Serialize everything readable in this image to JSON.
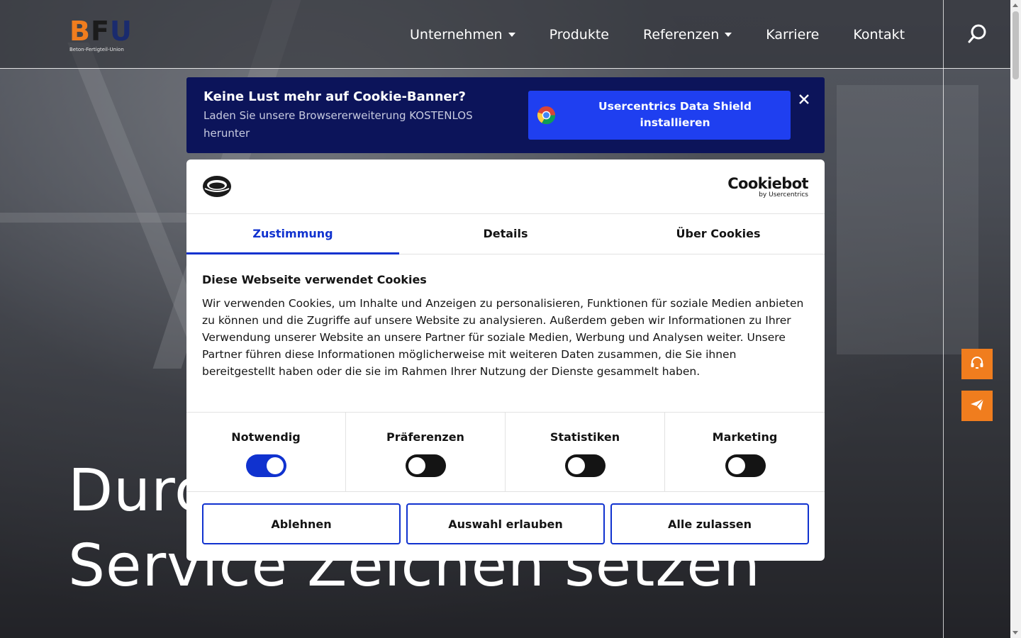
{
  "header": {
    "logo": {
      "letters": [
        "B",
        "F",
        "U"
      ],
      "subtitle": "Beton-Fertigteil-Union"
    },
    "nav": [
      {
        "label": "Unternehmen",
        "dropdown": true
      },
      {
        "label": "Produkte",
        "dropdown": false
      },
      {
        "label": "Referenzen",
        "dropdown": true
      },
      {
        "label": "Karriere",
        "dropdown": false
      },
      {
        "label": "Kontakt",
        "dropdown": false
      }
    ],
    "search_icon": "search-icon"
  },
  "hero": {
    "title_line1": "Durc",
    "title_line2": "Service Zeichen setzen"
  },
  "side_actions": [
    {
      "icon": "headset-icon"
    },
    {
      "icon": "paper-plane-icon"
    }
  ],
  "data_shield": {
    "title": "Keine Lust mehr auf Cookie-Banner?",
    "text": "Laden Sie unsere Browsererweiterung KOSTENLOS herunter",
    "button_label": "Usercentrics Data Shield installieren"
  },
  "cookie_dialog": {
    "brand": {
      "name": "Cookiebot",
      "byline": "by Usercentrics"
    },
    "tabs": [
      {
        "label": "Zustimmung",
        "active": true
      },
      {
        "label": "Details",
        "active": false
      },
      {
        "label": "Über Cookies",
        "active": false
      }
    ],
    "heading": "Diese Webseite verwendet Cookies",
    "body": "Wir verwenden Cookies, um Inhalte und Anzeigen zu personalisieren, Funktionen für soziale Medien anbieten zu können und die Zugriffe auf unsere Website zu analysieren. Außerdem geben wir Informationen zu Ihrer Verwendung unserer Website an unsere Partner für soziale Medien, Werbung und Analysen weiter. Unsere Partner führen diese Informationen möglicherweise mit weiteren Daten zusammen, die Sie ihnen bereitgestellt haben oder die sie im Rahmen Ihrer Nutzung der Dienste gesammelt haben.",
    "toggles": [
      {
        "label": "Notwendig",
        "on": true
      },
      {
        "label": "Präferenzen",
        "on": false
      },
      {
        "label": "Statistiken",
        "on": false
      },
      {
        "label": "Marketing",
        "on": false
      }
    ],
    "buttons": {
      "deny": "Ablehnen",
      "allow_selection": "Auswahl erlauben",
      "allow_all": "Alle zulassen"
    }
  },
  "colors": {
    "accent_orange": "#f07d1e",
    "cookiebot_blue": "#1032cf",
    "shield_navy": "#0c145a",
    "shield_button": "#1f3ff0"
  }
}
